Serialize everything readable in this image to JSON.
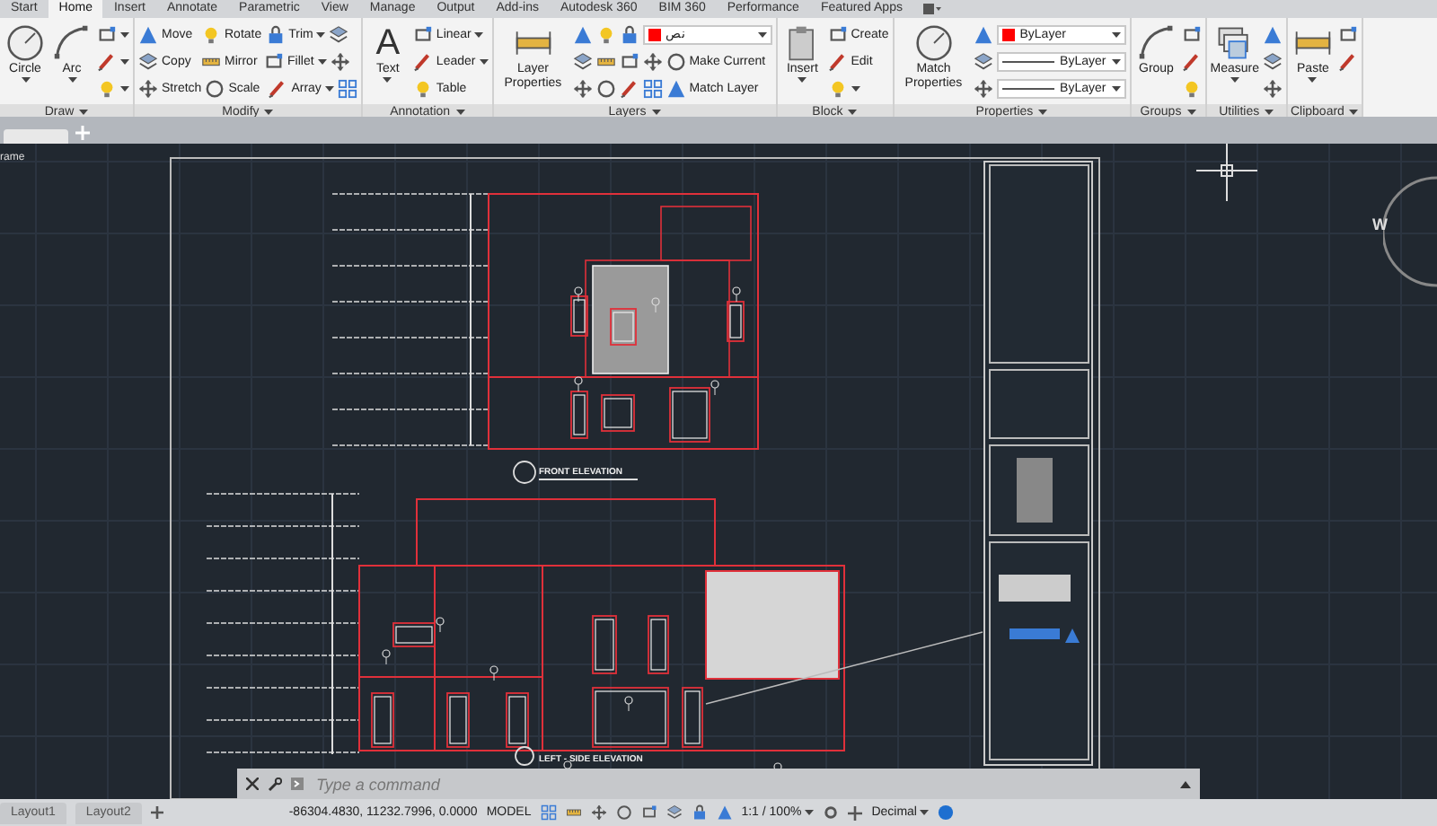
{
  "tabs": [
    {
      "label": "Start",
      "selected": false
    },
    {
      "label": "Home",
      "selected": true
    },
    {
      "label": "Insert",
      "selected": false
    },
    {
      "label": "Annotate",
      "selected": false
    },
    {
      "label": "Parametric",
      "selected": false
    },
    {
      "label": "View",
      "selected": false
    },
    {
      "label": "Manage",
      "selected": false
    },
    {
      "label": "Output",
      "selected": false
    },
    {
      "label": "Add-ins",
      "selected": false
    },
    {
      "label": "Autodesk 360",
      "selected": false
    },
    {
      "label": "BIM 360",
      "selected": false
    },
    {
      "label": "Performance",
      "selected": false
    },
    {
      "label": "Featured Apps",
      "selected": false
    }
  ],
  "panels": [
    {
      "title": "Draw",
      "large": [
        {
          "label": "Circle",
          "dropdown": true
        },
        {
          "label": "Arc",
          "dropdown": true
        }
      ],
      "rows": [
        [
          {
            "kind": "icon",
            "dropdown": true
          }
        ],
        [
          {
            "kind": "icon",
            "dropdown": true
          }
        ],
        [
          {
            "kind": "icon",
            "dropdown": true
          }
        ]
      ]
    },
    {
      "title": "Modify",
      "rows": [
        [
          {
            "kind": "small",
            "label": "Move",
            "dropdown": false
          },
          {
            "kind": "small",
            "label": "Rotate",
            "dropdown": false
          },
          {
            "kind": "small",
            "label": "Trim",
            "dropdown": true
          },
          {
            "kind": "icon",
            "dropdown": false
          }
        ],
        [
          {
            "kind": "small",
            "label": "Copy",
            "dropdown": false
          },
          {
            "kind": "small",
            "label": "Mirror",
            "dropdown": false
          },
          {
            "kind": "small",
            "label": "Fillet",
            "dropdown": true
          },
          {
            "kind": "icon",
            "dropdown": false
          }
        ],
        [
          {
            "kind": "small",
            "label": "Stretch",
            "dropdown": false
          },
          {
            "kind": "small",
            "label": "Scale",
            "dropdown": false
          },
          {
            "kind": "small",
            "label": "Array",
            "dropdown": true
          },
          {
            "kind": "icon",
            "dropdown": false
          }
        ]
      ]
    },
    {
      "title": "Annotation",
      "large": [
        {
          "label": "Text",
          "glyph": "A",
          "dropdown": true
        }
      ],
      "rows": [
        [
          {
            "kind": "small",
            "label": "Linear",
            "dropdown": true
          }
        ],
        [
          {
            "kind": "small",
            "label": "Leader",
            "dropdown": true
          }
        ],
        [
          {
            "kind": "small",
            "label": "Table",
            "dropdown": false
          }
        ]
      ]
    },
    {
      "title": "Layers",
      "large": [
        {
          "label": "Layer Properties",
          "dropdown": false
        }
      ],
      "rows": [
        [
          {
            "kind": "icon",
            "dropdown": false
          },
          {
            "kind": "icon",
            "dropdown": false
          },
          {
            "kind": "icon",
            "dropdown": false
          },
          {
            "kind": "color-dropdown",
            "value": "نص",
            "color": "#ff0000"
          }
        ],
        [
          {
            "kind": "icon",
            "dropdown": false
          },
          {
            "kind": "icon",
            "dropdown": false
          },
          {
            "kind": "icon",
            "dropdown": false
          },
          {
            "kind": "icon",
            "dropdown": false
          },
          {
            "kind": "small",
            "label": "Make Current",
            "dropdown": false
          }
        ],
        [
          {
            "kind": "icon",
            "dropdown": false
          },
          {
            "kind": "icon",
            "dropdown": false
          },
          {
            "kind": "icon",
            "dropdown": false
          },
          {
            "kind": "icon",
            "dropdown": false
          },
          {
            "kind": "small",
            "label": "Match Layer",
            "dropdown": false
          }
        ]
      ]
    },
    {
      "title": "Block",
      "large": [
        {
          "label": "Insert",
          "dropdown": true
        }
      ],
      "rows": [
        [
          {
            "kind": "small",
            "label": "Create",
            "dropdown": false
          }
        ],
        [
          {
            "kind": "small",
            "label": "Edit",
            "dropdown": false
          }
        ],
        [
          {
            "kind": "icon",
            "dropdown": true
          }
        ]
      ]
    },
    {
      "title": "Properties",
      "large": [
        {
          "label": "Match Properties",
          "dropdown": false
        }
      ],
      "rows": [
        [
          {
            "kind": "icon",
            "dropdown": false
          },
          {
            "kind": "color-dropdown",
            "value": "ByLayer",
            "color": "#ff0000"
          }
        ],
        [
          {
            "kind": "icon",
            "dropdown": false
          },
          {
            "kind": "line-dropdown",
            "value": "ByLayer"
          }
        ],
        [
          {
            "kind": "icon",
            "dropdown": false
          },
          {
            "kind": "line-dropdown",
            "value": "ByLayer"
          }
        ]
      ]
    },
    {
      "title": "Groups",
      "large": [
        {
          "label": "Group",
          "dropdown": false
        }
      ],
      "rows": [
        [
          {
            "kind": "icon",
            "dropdown": false
          }
        ],
        [
          {
            "kind": "icon",
            "dropdown": false
          }
        ],
        [
          {
            "kind": "icon",
            "dropdown": false
          }
        ]
      ]
    },
    {
      "title": "Utilities",
      "large": [
        {
          "label": "Measure",
          "dropdown": true
        }
      ],
      "rows": [
        [
          {
            "kind": "icon",
            "dropdown": false
          }
        ],
        [
          {
            "kind": "icon",
            "dropdown": false
          }
        ],
        [
          {
            "kind": "icon",
            "dropdown": false
          }
        ]
      ]
    },
    {
      "title": "Clipboard",
      "large": [
        {
          "label": "Paste",
          "dropdown": true
        }
      ],
      "rows": [
        [
          {
            "kind": "icon",
            "dropdown": false
          }
        ],
        [
          {
            "kind": "icon",
            "dropdown": false
          }
        ],
        []
      ]
    }
  ],
  "canvas": {
    "frame_label": "rame",
    "labels": [
      "FRONT ELEVATION",
      "LEFT - SIDE ELEVATION"
    ],
    "compass": "W"
  },
  "command_line": {
    "placeholder": "Type a command"
  },
  "status_bar": {
    "layouts": [
      {
        "label": "Layout1",
        "selected": false
      },
      {
        "label": "Layout2",
        "selected": false
      }
    ],
    "coordinates": "-86304.4830, 11232.7996, 0.0000",
    "mode": "MODEL",
    "scale": "1:1 / 100%",
    "units": "Decimal"
  }
}
